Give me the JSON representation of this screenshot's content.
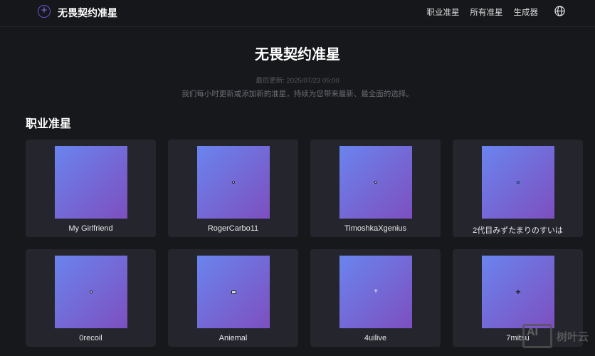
{
  "nav": {
    "brand": "无畏契约准星",
    "links": [
      "职业准星",
      "所有准星",
      "生成器"
    ]
  },
  "hero": {
    "title": "无畏契约准星",
    "updated": "最后更新: 2025/07/23 05:00",
    "description": "我们每小时更新或添加新的准星，持续为您带来最新、最全面的选择。"
  },
  "section": {
    "title": "职业准星"
  },
  "cards": [
    {
      "name": "My Girlfriend",
      "crosshair": "none"
    },
    {
      "name": "RogerCarbo11",
      "crosshair": "dot"
    },
    {
      "name": "TimoshkaXgenius",
      "crosshair": "dot"
    },
    {
      "name": "2代目みずたまりのすいは",
      "crosshair": "cyan-dot"
    },
    {
      "name": "0recoil",
      "crosshair": "dot"
    },
    {
      "name": "Aniemal",
      "crosshair": "small-cross"
    },
    {
      "name": "4uilive",
      "crosshair": "white-plus"
    },
    {
      "name": "7mitsu",
      "crosshair": "dark-plus"
    }
  ],
  "watermark": {
    "logo": "AI",
    "text": "树叶云"
  }
}
